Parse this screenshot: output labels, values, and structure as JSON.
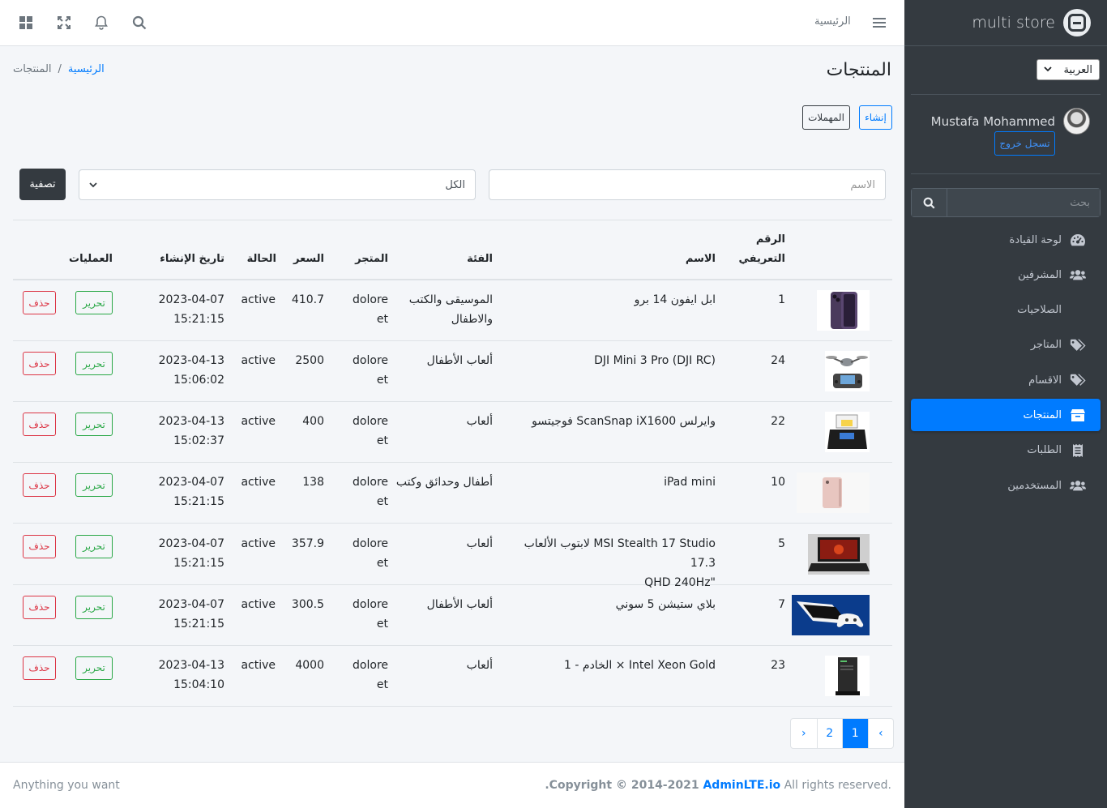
{
  "brand": {
    "name": "multi store"
  },
  "language": {
    "selected": "العربية"
  },
  "user": {
    "name": "Mustafa Mohammed",
    "logout_label": "تسجل خروج"
  },
  "sidebar_search": {
    "placeholder": "بحث"
  },
  "nav": [
    {
      "label": "لوحة القيادة",
      "icon": "dashboard-icon",
      "active": false
    },
    {
      "label": "المشرفين",
      "icon": "users-icon",
      "active": false
    },
    {
      "label": "الصلاحيات",
      "icon": "",
      "active": false
    },
    {
      "label": "المتاجر",
      "icon": "tags-icon",
      "active": false
    },
    {
      "label": "الاقسام",
      "icon": "tags-icon",
      "active": false
    },
    {
      "label": "المنتجات",
      "icon": "box-icon",
      "active": true
    },
    {
      "label": "الطلبات",
      "icon": "receipt-icon",
      "active": false
    },
    {
      "label": "المستخدمين",
      "icon": "users-icon",
      "active": false
    }
  ],
  "topbar": {
    "home_label": "الرئيسية"
  },
  "page": {
    "title": "المنتجات",
    "breadcrumb_home": "الرئيسية",
    "breadcrumb_current": "المنتجات",
    "create_label": "إنشاء",
    "trash_label": "المهملات"
  },
  "filters": {
    "name_placeholder": "الاسم",
    "category_selected": "الكل",
    "submit_label": "تصفية"
  },
  "table": {
    "headers": {
      "id_line1": "الرقم",
      "id_line2": "التعريفي",
      "name": "الاسم",
      "category": "الفئة",
      "store": "المتجر",
      "price": "السعر",
      "status": "الحالة",
      "created": "تاريخ الإنشاء",
      "actions": "العمليات"
    },
    "edit_label": "تحرير",
    "delete_label": "حذف",
    "rows": [
      {
        "id": "1",
        "name_1": "ابل ايفون 14 برو",
        "name_2": "",
        "category_1": "الموسيقى والكتب",
        "category_2": "والاطفال",
        "store_1": "dolore",
        "store_2": "et",
        "price": "410.7",
        "status": "active",
        "date": "2023-04-07",
        "time": "15:21:15",
        "image": "phone"
      },
      {
        "id": "24",
        "name_1": "DJI Mini 3 Pro (DJI RC)",
        "name_2": "",
        "category_1": "ألعاب الأطفال",
        "category_2": "",
        "store_1": "dolore",
        "store_2": "et",
        "price": "2500",
        "status": "active",
        "date": "2023-04-13",
        "time": "15:06:02",
        "image": "drone"
      },
      {
        "id": "22",
        "name_1": "فوجيتسو ScanSnap iX1600 وايرلس",
        "name_2": "",
        "category_1": "ألعاب",
        "category_2": "",
        "store_1": "dolore",
        "store_2": "et",
        "price": "400",
        "status": "active",
        "date": "2023-04-13",
        "time": "15:02:37",
        "image": "scanner"
      },
      {
        "id": "10",
        "name_1": "iPad mini",
        "name_2": "",
        "category_1": "أطفال وحدائق وكتب",
        "category_2": "",
        "store_1": "dolore",
        "store_2": "et",
        "price": "138",
        "status": "active",
        "date": "2023-04-07",
        "time": "15:21:15",
        "image": "ipad"
      },
      {
        "id": "5",
        "name_1": "لابتوب الألعاب MSI Stealth 17 Studio 17.3",
        "name_2": "QHD 240Hz\"",
        "category_1": "ألعاب",
        "category_2": "",
        "store_1": "dolore",
        "store_2": "et",
        "price": "357.9",
        "status": "active",
        "date": "2023-04-07",
        "time": "15:21:15",
        "image": "laptop"
      },
      {
        "id": "7",
        "name_1": "بلاي ستيشن 5 سوني",
        "name_2": "",
        "category_1": "ألعاب الأطفال",
        "category_2": "",
        "store_1": "dolore",
        "store_2": "et",
        "price": "300.5",
        "status": "active",
        "date": "2023-04-07",
        "time": "15:21:15",
        "image": "console"
      },
      {
        "id": "23",
        "name_1": "الخادم - 1 × Intel Xeon Gold",
        "name_2": "",
        "category_1": "ألعاب",
        "category_2": "",
        "store_1": "dolore",
        "store_2": "et",
        "price": "4000",
        "status": "active",
        "date": "2023-04-13",
        "time": "15:04:10",
        "image": "server"
      }
    ]
  },
  "pagination": {
    "prev": "‹",
    "pages": [
      "1",
      "2"
    ],
    "current": "1",
    "next": "›"
  },
  "footer": {
    "left": "Anything you want",
    "copyright": "Copyright © 2014-2021 ",
    "link": "AdminLTE.io",
    "dot": ".",
    "rights": " All rights reserved."
  },
  "colors": {
    "primary": "#007bff",
    "sidebar": "#343a40",
    "success": "#28a745",
    "danger": "#dc3545"
  }
}
